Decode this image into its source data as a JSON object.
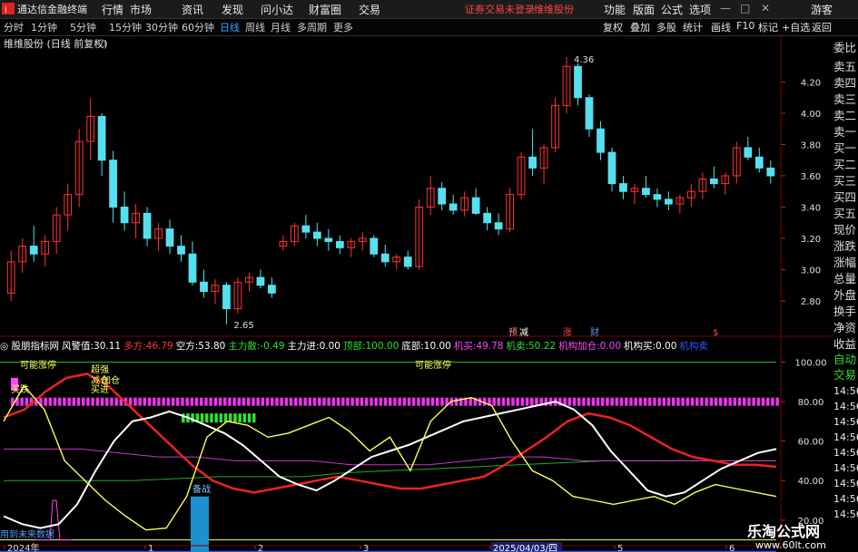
{
  "app": {
    "title": "通达信金融终端",
    "menu": [
      "行情",
      "市场",
      "资讯",
      "发现",
      "问小达",
      "财富圈",
      "交易"
    ],
    "notice": "证券交易未登录",
    "stock_name_top": "维维股份",
    "right_menu": [
      "功能",
      "版面",
      "公式",
      "选项"
    ],
    "guest": "游客"
  },
  "periods": [
    "分时",
    "1分钟",
    "5分钟",
    "15分钟",
    "30分钟",
    "60分钟",
    "日线",
    "周线",
    "月线",
    "多周期",
    "更多"
  ],
  "active_period": "日线",
  "toolbar": [
    "复权",
    "叠加",
    "多股",
    "统计",
    "画线",
    "F10",
    "标记",
    "+自选",
    "返回"
  ],
  "chart_title": "维维股份 (日线 前复权)",
  "colors": {
    "up": "#ff3333",
    "down": "#55e0f0",
    "ma": "#ffffff",
    "bg": "#000000"
  },
  "chart_data": {
    "type": "candlestick",
    "title": "维维股份 (日线 前复权)",
    "y_ticks": [
      2.8,
      3.0,
      3.2,
      3.4,
      3.6,
      3.8,
      4.0,
      4.2
    ],
    "ylim": [
      2.62,
      4.4
    ],
    "annotations": [
      {
        "label": "4.36",
        "kind": "high"
      },
      {
        "label": "2.65",
        "kind": "low"
      }
    ],
    "x_ticks": [
      "2024年",
      "1",
      "2",
      "3",
      "2025/04/03/四",
      "5",
      "6"
    ],
    "event_marks": [
      "预",
      "减",
      "涨",
      "财",
      "$"
    ],
    "candles": [
      [
        2.85,
        3.12,
        2.8,
        3.05
      ],
      [
        3.05,
        3.2,
        2.98,
        3.15
      ],
      [
        3.15,
        3.28,
        3.05,
        3.1
      ],
      [
        3.1,
        3.22,
        3.02,
        3.18
      ],
      [
        3.18,
        3.4,
        3.1,
        3.35
      ],
      [
        3.35,
        3.55,
        3.25,
        3.48
      ],
      [
        3.48,
        3.9,
        3.4,
        3.82
      ],
      [
        3.82,
        4.1,
        3.7,
        3.98
      ],
      [
        3.98,
        4.0,
        3.6,
        3.7
      ],
      [
        3.7,
        3.76,
        3.3,
        3.4
      ],
      [
        3.4,
        3.5,
        3.25,
        3.3
      ],
      [
        3.3,
        3.42,
        3.2,
        3.36
      ],
      [
        3.36,
        3.4,
        3.15,
        3.2
      ],
      [
        3.2,
        3.3,
        3.12,
        3.26
      ],
      [
        3.26,
        3.32,
        3.1,
        3.15
      ],
      [
        3.15,
        3.22,
        3.05,
        3.1
      ],
      [
        3.1,
        3.18,
        2.9,
        2.92
      ],
      [
        2.92,
        3.0,
        2.82,
        2.86
      ],
      [
        2.86,
        2.94,
        2.78,
        2.9
      ],
      [
        2.9,
        2.92,
        2.65,
        2.75
      ],
      [
        2.75,
        2.95,
        2.72,
        2.92
      ],
      [
        2.92,
        2.98,
        2.86,
        2.95
      ],
      [
        2.95,
        3.0,
        2.88,
        2.9
      ],
      [
        2.9,
        2.95,
        2.82,
        2.85
      ],
      [
        3.15,
        3.22,
        3.12,
        3.18
      ],
      [
        3.18,
        3.3,
        3.15,
        3.28
      ],
      [
        3.28,
        3.35,
        3.2,
        3.24
      ],
      [
        3.24,
        3.3,
        3.15,
        3.2
      ],
      [
        3.2,
        3.26,
        3.12,
        3.18
      ],
      [
        3.18,
        3.22,
        3.1,
        3.14
      ],
      [
        3.14,
        3.2,
        3.08,
        3.18
      ],
      [
        3.18,
        3.24,
        3.12,
        3.2
      ],
      [
        3.2,
        3.22,
        3.08,
        3.1
      ],
      [
        3.1,
        3.16,
        3.02,
        3.05
      ],
      [
        3.05,
        3.1,
        3.0,
        3.08
      ],
      [
        3.08,
        3.12,
        3.0,
        3.02
      ],
      [
        3.02,
        3.45,
        3.0,
        3.4
      ],
      [
        3.4,
        3.6,
        3.35,
        3.52
      ],
      [
        3.52,
        3.56,
        3.38,
        3.42
      ],
      [
        3.42,
        3.48,
        3.35,
        3.38
      ],
      [
        3.38,
        3.5,
        3.34,
        3.46
      ],
      [
        3.46,
        3.52,
        3.35,
        3.36
      ],
      [
        3.36,
        3.4,
        3.25,
        3.3
      ],
      [
        3.3,
        3.36,
        3.22,
        3.26
      ],
      [
        3.26,
        3.52,
        3.24,
        3.48
      ],
      [
        3.48,
        3.75,
        3.45,
        3.72
      ],
      [
        3.72,
        3.9,
        3.6,
        3.65
      ],
      [
        3.65,
        3.8,
        3.55,
        3.78
      ],
      [
        3.78,
        4.1,
        3.75,
        4.05
      ],
      [
        4.05,
        4.36,
        4.0,
        4.3
      ],
      [
        4.3,
        4.32,
        4.05,
        4.1
      ],
      [
        4.1,
        4.12,
        3.85,
        3.9
      ],
      [
        3.9,
        3.95,
        3.7,
        3.75
      ],
      [
        3.75,
        3.78,
        3.5,
        3.55
      ],
      [
        3.55,
        3.6,
        3.45,
        3.5
      ],
      [
        3.5,
        3.55,
        3.42,
        3.52
      ],
      [
        3.52,
        3.6,
        3.46,
        3.48
      ],
      [
        3.48,
        3.52,
        3.4,
        3.45
      ],
      [
        3.45,
        3.5,
        3.38,
        3.42
      ],
      [
        3.42,
        3.48,
        3.36,
        3.46
      ],
      [
        3.46,
        3.55,
        3.4,
        3.5
      ],
      [
        3.5,
        3.62,
        3.45,
        3.58
      ],
      [
        3.58,
        3.66,
        3.52,
        3.55
      ],
      [
        3.55,
        3.62,
        3.48,
        3.6
      ],
      [
        3.6,
        3.82,
        3.55,
        3.78
      ],
      [
        3.78,
        3.85,
        3.7,
        3.72
      ],
      [
        3.72,
        3.78,
        3.62,
        3.65
      ],
      [
        3.65,
        3.7,
        3.55,
        3.6
      ]
    ]
  },
  "indicator": {
    "name": "股朋指标网",
    "fields": [
      {
        "label": "风警值:",
        "value": "30.11",
        "color": "#ffffff"
      },
      {
        "label": "多方:",
        "value": "46.79",
        "color": "#ff3333"
      },
      {
        "label": "空方:",
        "value": "53.80",
        "color": "#ffffff"
      },
      {
        "label": "主力散:",
        "value": "-0.49",
        "color": "#33dd33"
      },
      {
        "label": "主力进:",
        "value": "0.00",
        "color": "#ffffff"
      },
      {
        "label": "顶部:",
        "value": "100.00",
        "color": "#33dd33"
      },
      {
        "label": "底部:",
        "value": "10.00",
        "color": "#ffffff"
      },
      {
        "label": "机买:",
        "value": "49.78",
        "color": "#ff44ff"
      },
      {
        "label": "机卖:",
        "value": "50.22",
        "color": "#33dd33"
      },
      {
        "label": "机构加仓:",
        "value": "0.00",
        "color": "#ff44ff"
      },
      {
        "label": "机构买:",
        "value": "0.00",
        "color": "#ffffff"
      },
      {
        "label": "机构卖",
        "value": "",
        "color": "#3355ff"
      }
    ],
    "y_ticks": [
      20.0,
      40.0,
      60.0,
      80.0,
      100.0
    ],
    "ylim": [
      8,
      108
    ],
    "text_labels": [
      "可能涨停",
      "可能涨停",
      "超强",
      "买进",
      "备战",
      "加仓",
      "买跌",
      "减仓",
      "用到未来数据"
    ],
    "lines": {
      "white": [
        22,
        18,
        16,
        18,
        28,
        45,
        60,
        70,
        72,
        75,
        72,
        68,
        64,
        58,
        50,
        42,
        38,
        35,
        40,
        46,
        52,
        55,
        58,
        62,
        66,
        70,
        72,
        74,
        76,
        78,
        80,
        76,
        68,
        55,
        45,
        35,
        32,
        34,
        40,
        46,
        50,
        54,
        56
      ],
      "red": [
        72,
        76,
        85,
        92,
        94,
        88,
        78,
        68,
        58,
        48,
        40,
        36,
        34,
        36,
        38,
        40,
        42,
        40,
        38,
        36,
        36,
        38,
        40,
        42,
        48,
        55,
        62,
        70,
        74,
        72,
        68,
        62,
        56,
        52,
        50,
        48,
        48,
        47
      ],
      "yellow": [
        70,
        88,
        76,
        50,
        40,
        30,
        22,
        15,
        16,
        32,
        62,
        70,
        68,
        62,
        64,
        68,
        72,
        65,
        55,
        62,
        45,
        70,
        80,
        82,
        78,
        60,
        45,
        40,
        32,
        30,
        28,
        30,
        32,
        28,
        34,
        38,
        36,
        34,
        32
      ],
      "magenta": [
        56,
        56,
        56,
        54,
        52,
        52,
        50,
        50,
        50,
        48,
        48,
        48,
        50,
        52,
        52,
        50,
        50,
        50,
        50,
        50,
        50
      ],
      "green": [
        40,
        40,
        40,
        40,
        41,
        42,
        42,
        42,
        44,
        45,
        46,
        47,
        48,
        49,
        50,
        50,
        50,
        50,
        50
      ]
    }
  },
  "side_panel": {
    "labels": [
      "委比",
      "卖五",
      "卖四",
      "卖三",
      "卖二",
      "卖一",
      "买一",
      "买二",
      "买三",
      "买四",
      "买五",
      "现价",
      "涨跌",
      "涨幅",
      "总量",
      "外盘",
      "换手",
      "净资",
      "收益"
    ],
    "lower_labels": [
      "自动",
      "交易"
    ],
    "times": [
      "14:56",
      "14:56",
      "14:56",
      "14:56",
      "14:56",
      "14:56",
      "14:56",
      "14:56",
      "14:56",
      "14:56"
    ]
  },
  "watermark": {
    "line1": "乐淘公式网",
    "line2": "www.60lt.com"
  }
}
